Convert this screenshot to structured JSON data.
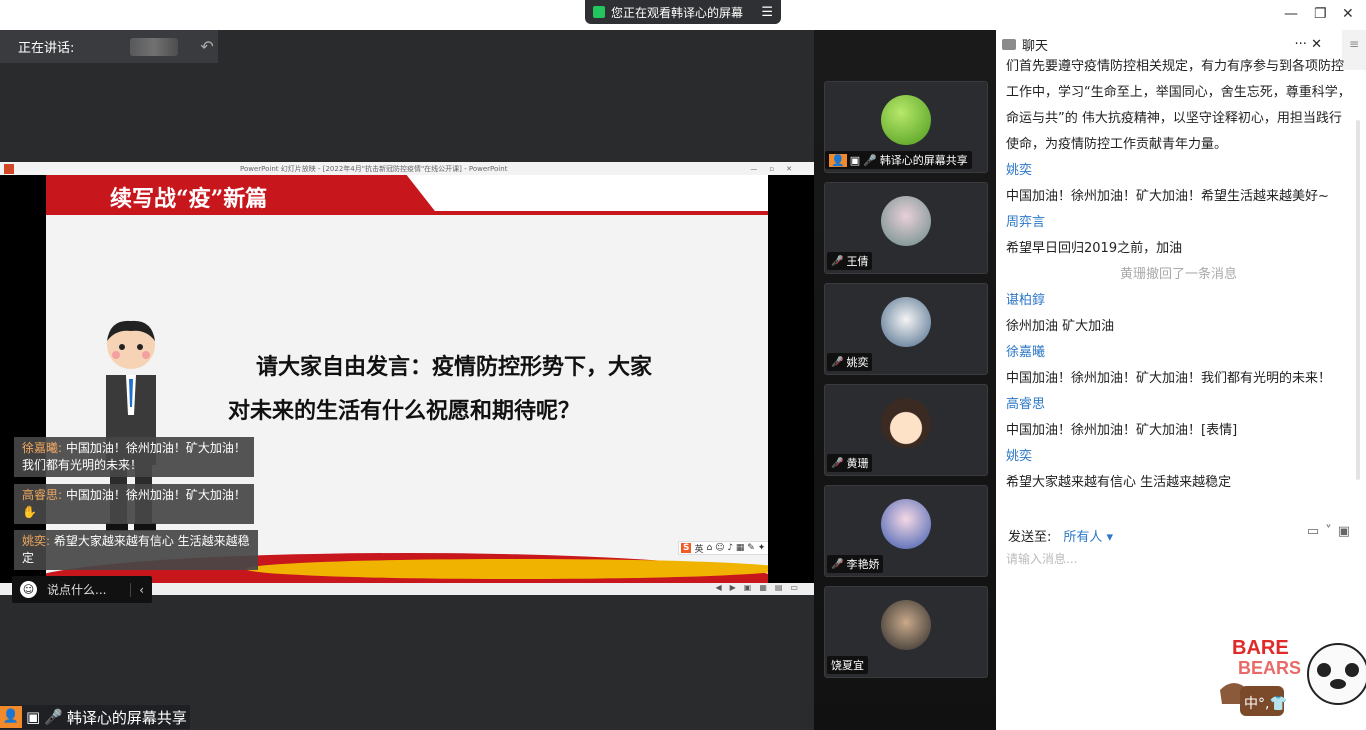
{
  "top": {
    "banner_text": "您正在观看韩译心的屏幕",
    "win_min": "—",
    "win_restore": "❐",
    "win_close": "✕"
  },
  "speaking": {
    "label": "正在讲话:",
    "back_icon": "↶"
  },
  "ppt": {
    "titlebar": "PowerPoint 幻灯片放映 - [2022年4月\"抗击新冠防控疫情\"在线公开课] - PowerPoint",
    "slide_title": "续写战“疫”新篇",
    "question_line1": "请大家自由发言：疫情防控形势下，大家",
    "question_line2": "对未来的生活有什么祝愿和期待呢？",
    "ime_label": "英"
  },
  "overlay": [
    {
      "name": "徐嘉曦:",
      "text": " 中国加油！徐州加油！矿大加油！我们都有光明的未来！"
    },
    {
      "name": "高睿思:",
      "text": " 中国加油！徐州加油！矿大加油！"
    },
    {
      "name": "姚奕:",
      "text": " 希望大家越来越有信心 生活越来越稳定"
    }
  ],
  "say_placeholder": "说点什么...",
  "bottom_label": "韩译心的屏幕共享",
  "participants": [
    {
      "name": "韩译心的屏幕共享"
    },
    {
      "name": "王倩"
    },
    {
      "name": "姚奕"
    },
    {
      "name": "黄珊"
    },
    {
      "name": "李艳娇"
    },
    {
      "name": "饶夏宜"
    }
  ],
  "chat": {
    "title": "聊天",
    "more": "···",
    "close": "✕",
    "side": "≡",
    "intro": "们首先要遵守疫情防控相关规定，有力有序参与到各项防控工作中，学习“生命至上，举国同心，舍生忘死，尊重科学，命运与共”的 伟大抗疫精神，以坚守诠释初心，用担当践行使命，为疫情防控工作贡献青年力量。",
    "messages": [
      {
        "name": "姚奕",
        "text": "中国加油！徐州加油！矿大加油！希望生活越来越美好~"
      },
      {
        "name": "周弈言",
        "text": "希望早日回归2019之前，加油"
      },
      {
        "system": "黄珊撤回了一条消息"
      },
      {
        "name": "谌柏錞",
        "text": "徐州加油 矿大加油"
      },
      {
        "name": "徐嘉曦",
        "text": "中国加油！徐州加油！矿大加油！我们都有光明的未来！"
      },
      {
        "name": "高睿思",
        "text": "中国加油！徐州加油！矿大加油！[表情]"
      },
      {
        "name": "姚奕",
        "text": "希望大家越来越有信心 生活越来越稳定"
      }
    ],
    "send_to_label": "发送至:",
    "send_to_value": "所有人 ▾",
    "input_placeholder": "请输入消息..."
  }
}
